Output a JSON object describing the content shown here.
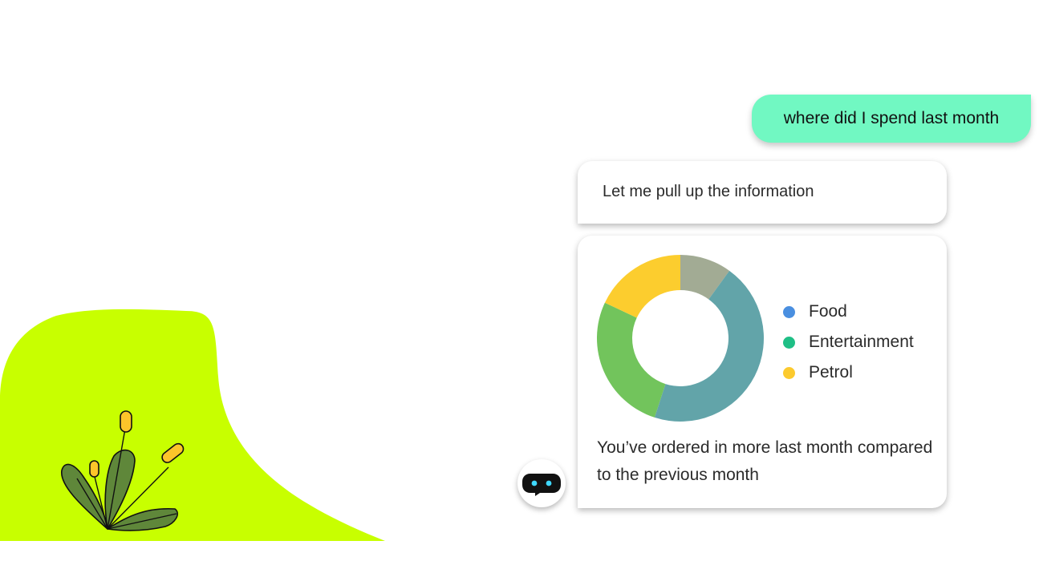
{
  "conversation": {
    "user_message": "where did I spend last month",
    "assistant_intro": "Let me pull up the information",
    "assistant_summary": "You’ve ordered in more last month compared to the previous month"
  },
  "legend": [
    {
      "label": "Food",
      "color": "#4a8fe0"
    },
    {
      "label": "Entertainment",
      "color": "#1fbf86"
    },
    {
      "label": "Petrol",
      "color": "#fcca2e"
    }
  ],
  "colors": {
    "user_bubble": "#71f8c2",
    "blob": "#c8ff00",
    "donut_slices": [
      "#a2ab94",
      "#62a4a9",
      "#72c45c",
      "#fccd2e"
    ]
  },
  "icons": {
    "bot_avatar": "robot-face-icon",
    "decoration": "cattail-plant-icon"
  },
  "chart_data": {
    "type": "pie",
    "style": "donut",
    "values": [
      10,
      45,
      27,
      18
    ],
    "colors": [
      "#a2ab94",
      "#62a4a9",
      "#72c45c",
      "#fccd2e"
    ]
  }
}
